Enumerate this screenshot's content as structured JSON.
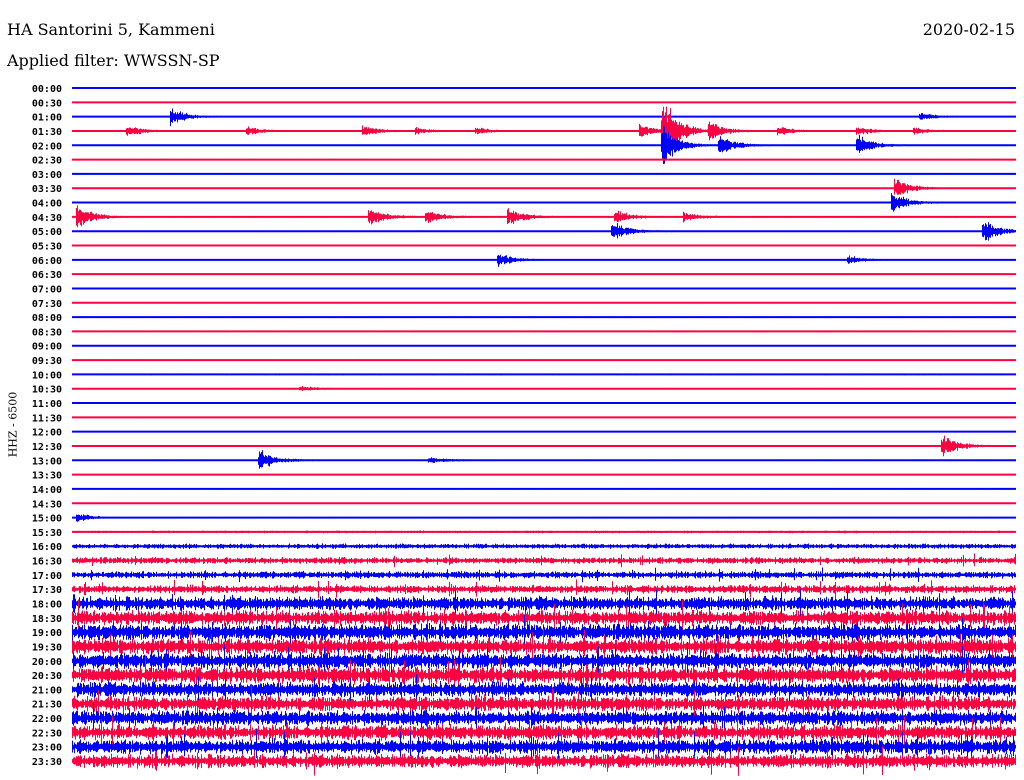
{
  "header": {
    "station": "HA Santorini 5, Kammeni",
    "date": "2020-02-15",
    "filter": "Applied filter: WWSSN-SP"
  },
  "chart_data": {
    "type": "helicorder",
    "title": "HA Santorini 5, Kammeni",
    "ylabel": "HHZ - 6500",
    "minutes_per_line": 30,
    "colors": {
      "even": "#0000ff",
      "odd": "#ff0040"
    },
    "lines": [
      {
        "t": "00:00",
        "noise": 0.3
      },
      {
        "t": "00:30",
        "noise": 0.4
      },
      {
        "t": "01:00",
        "noise": 0.4
      },
      {
        "t": "01:30",
        "noise": 0.5
      },
      {
        "t": "02:00",
        "noise": 0.5
      },
      {
        "t": "02:30",
        "noise": 0.4
      },
      {
        "t": "03:00",
        "noise": 0.4
      },
      {
        "t": "03:30",
        "noise": 0.5
      },
      {
        "t": "04:00",
        "noise": 0.6
      },
      {
        "t": "04:30",
        "noise": 0.6
      },
      {
        "t": "05:00",
        "noise": 0.6
      },
      {
        "t": "05:30",
        "noise": 0.5
      },
      {
        "t": "06:00",
        "noise": 0.4
      },
      {
        "t": "06:30",
        "noise": 0.4
      },
      {
        "t": "07:00",
        "noise": 0.6
      },
      {
        "t": "07:30",
        "noise": 0.5
      },
      {
        "t": "08:00",
        "noise": 0.6
      },
      {
        "t": "08:30",
        "noise": 0.5
      },
      {
        "t": "09:00",
        "noise": 0.5
      },
      {
        "t": "09:30",
        "noise": 0.4
      },
      {
        "t": "10:00",
        "noise": 0.6
      },
      {
        "t": "10:30",
        "noise": 0.6
      },
      {
        "t": "11:00",
        "noise": 0.6
      },
      {
        "t": "11:30",
        "noise": 0.6
      },
      {
        "t": "12:00",
        "noise": 0.5
      },
      {
        "t": "12:30",
        "noise": 0.6
      },
      {
        "t": "13:00",
        "noise": 0.6
      },
      {
        "t": "13:30",
        "noise": 0.5
      },
      {
        "t": "14:00",
        "noise": 0.4
      },
      {
        "t": "14:30",
        "noise": 0.4
      },
      {
        "t": "15:00",
        "noise": 0.4
      },
      {
        "t": "15:30",
        "noise": 1.0
      },
      {
        "t": "16:00",
        "noise": 2.0
      },
      {
        "t": "16:30",
        "noise": 2.6
      },
      {
        "t": "17:00",
        "noise": 2.8
      },
      {
        "t": "17:30",
        "noise": 3.2
      },
      {
        "t": "18:00",
        "noise": 5.5
      },
      {
        "t": "18:30",
        "noise": 6.0
      },
      {
        "t": "19:00",
        "noise": 6.5
      },
      {
        "t": "19:30",
        "noise": 6.5
      },
      {
        "t": "20:00",
        "noise": 6.5
      },
      {
        "t": "20:30",
        "noise": 6.5
      },
      {
        "t": "21:00",
        "noise": 6.0
      },
      {
        "t": "21:30",
        "noise": 6.0
      },
      {
        "t": "22:00",
        "noise": 6.0
      },
      {
        "t": "22:30",
        "noise": 6.0
      },
      {
        "t": "23:00",
        "noise": 6.0
      },
      {
        "t": "23:30",
        "noise": 5.5
      }
    ],
    "events": [
      {
        "line": "01:00",
        "min": 3.2,
        "amp": 8
      },
      {
        "line": "01:00",
        "min": 27.0,
        "amp": 4
      },
      {
        "line": "01:30",
        "min": 1.8,
        "amp": 5
      },
      {
        "line": "01:30",
        "min": 5.6,
        "amp": 4
      },
      {
        "line": "01:30",
        "min": 9.3,
        "amp": 5
      },
      {
        "line": "01:30",
        "min": 11.0,
        "amp": 3
      },
      {
        "line": "01:30",
        "min": 12.9,
        "amp": 3
      },
      {
        "line": "01:30",
        "min": 18.1,
        "amp": 6
      },
      {
        "line": "01:30",
        "min": 18.8,
        "amp": 30
      },
      {
        "line": "01:30",
        "min": 20.3,
        "amp": 8
      },
      {
        "line": "01:30",
        "min": 22.5,
        "amp": 4
      },
      {
        "line": "01:30",
        "min": 25.0,
        "amp": 4
      },
      {
        "line": "01:30",
        "min": 26.8,
        "amp": 3
      },
      {
        "line": "02:00",
        "min": 18.8,
        "amp": 18
      },
      {
        "line": "02:00",
        "min": 20.6,
        "amp": 10
      },
      {
        "line": "02:00",
        "min": 25.0,
        "amp": 9
      },
      {
        "line": "03:30",
        "min": 26.2,
        "amp": 9
      },
      {
        "line": "04:00",
        "min": 26.1,
        "amp": 9
      },
      {
        "line": "04:30",
        "min": 0.2,
        "amp": 10
      },
      {
        "line": "04:30",
        "min": 9.5,
        "amp": 8
      },
      {
        "line": "04:30",
        "min": 11.3,
        "amp": 6
      },
      {
        "line": "04:30",
        "min": 13.9,
        "amp": 8
      },
      {
        "line": "04:30",
        "min": 17.3,
        "amp": 6
      },
      {
        "line": "04:30",
        "min": 19.5,
        "amp": 4
      },
      {
        "line": "05:00",
        "min": 17.2,
        "amp": 9
      },
      {
        "line": "05:00",
        "min": 29.0,
        "amp": 10
      },
      {
        "line": "06:00",
        "min": 13.6,
        "amp": 6
      },
      {
        "line": "06:00",
        "min": 24.7,
        "amp": 4
      },
      {
        "line": "10:30",
        "min": 7.3,
        "amp": 2
      },
      {
        "line": "12:30",
        "min": 27.7,
        "amp": 10
      },
      {
        "line": "13:00",
        "min": 6.0,
        "amp": 9
      },
      {
        "line": "13:00",
        "min": 11.4,
        "amp": 3
      },
      {
        "line": "15:00",
        "min": 0.2,
        "amp": 4
      }
    ]
  }
}
